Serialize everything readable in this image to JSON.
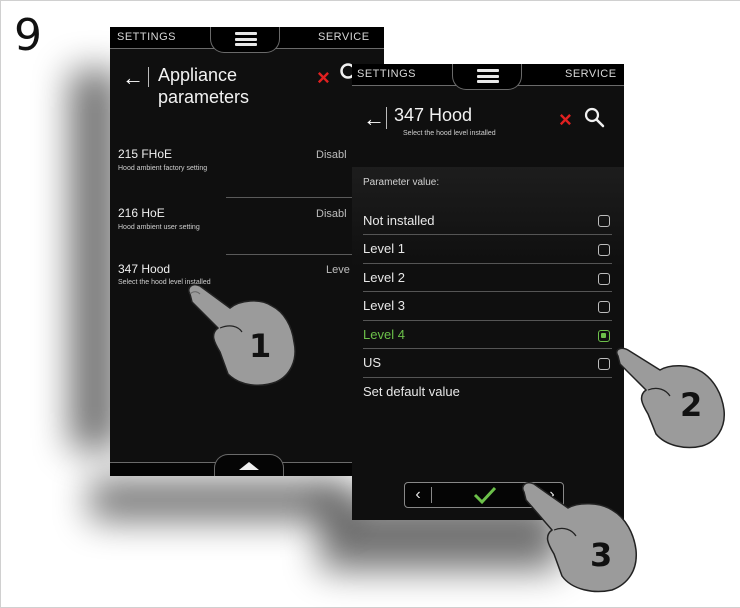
{
  "step_number": "9",
  "left_screen": {
    "tabs": {
      "settings": "SETTINGS",
      "service": "SERVICE"
    },
    "title_line1": "Appliance",
    "title_line2": "parameters",
    "icons": {
      "back": "back-arrow-icon",
      "close": "close-x-icon",
      "search": "search-icon",
      "menu": "hamburger-menu-icon",
      "scroll_up": "up-triangle-icon"
    },
    "params": [
      {
        "name": "215 FHoE",
        "desc": "Hood ambient factory setting",
        "value": "Disabl"
      },
      {
        "name": "216 HoE",
        "desc": "Hood ambient user setting",
        "value": "Disabl"
      },
      {
        "name": "347 Hood",
        "desc": "Select the hood level installed",
        "value": "Leve"
      }
    ]
  },
  "right_screen": {
    "tabs": {
      "settings": "SETTINGS",
      "service": "SERVICE"
    },
    "title": "347 Hood",
    "subtitle": "Select the hood level installed",
    "param_value_label": "Parameter value:",
    "options": [
      {
        "label": "Not installed",
        "checked": false
      },
      {
        "label": "Level 1",
        "checked": false
      },
      {
        "label": "Level 2",
        "checked": false
      },
      {
        "label": "Level 3",
        "checked": false
      },
      {
        "label": "Level 4",
        "checked": true
      },
      {
        "label": "US",
        "checked": false
      }
    ],
    "default_label": "Set default value",
    "nav": {
      "prev": "‹",
      "next": "›",
      "confirm": "✓"
    },
    "accent_color": "#6cc04a"
  },
  "callouts": {
    "first": "1",
    "second": "2",
    "third": "3"
  }
}
